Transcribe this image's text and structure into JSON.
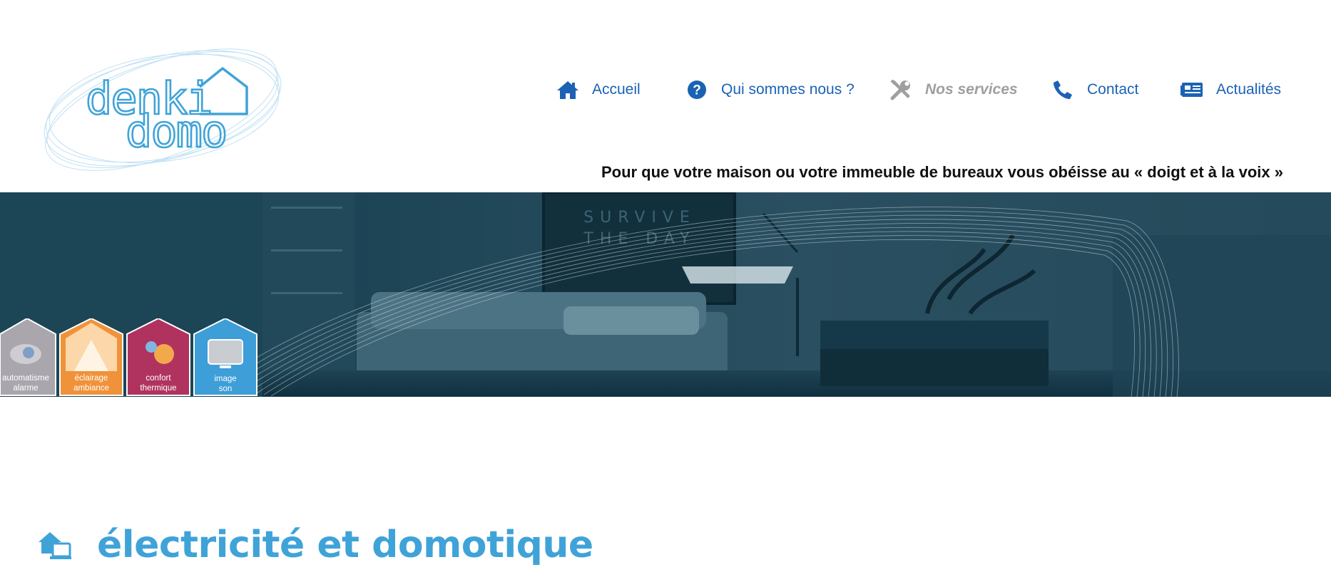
{
  "brand": {
    "logo_top": "denki",
    "logo_bottom": "domo",
    "colors": {
      "logo": "#3fa3d8",
      "nav": "#1b62b5",
      "nav_active": "#9f9f9f",
      "banner": "#1c4556",
      "title": "#3fa3d8"
    }
  },
  "nav": {
    "items": [
      {
        "label": "Accueil",
        "icon": "home-icon"
      },
      {
        "label": "Qui sommes nous ?",
        "icon": "question-circle-icon"
      },
      {
        "label": "Nos services",
        "icon": "tools-icon",
        "active": true
      },
      {
        "label": "Contact",
        "icon": "phone-icon"
      },
      {
        "label": "Actualités",
        "icon": "newspaper-icon"
      }
    ]
  },
  "tagline": "Pour que votre maison ou votre immeuble de bureaux vous obéisse au « doigt et à la voix »",
  "banner": {
    "wall_text_line1": "SURVIVE",
    "wall_text_line2": "THE DAY",
    "tiles": [
      {
        "line1": "automatisme",
        "line2": "alarme",
        "color": "#a9a6ad"
      },
      {
        "line1": "éclairage",
        "line2": "ambiance",
        "color": "#f0923a"
      },
      {
        "line1": "confort",
        "line2": "thermique",
        "color": "#b0335f"
      },
      {
        "line1": "image",
        "line2": "son",
        "color": "#3d9ed8"
      }
    ]
  },
  "section": {
    "title": "électricité et domotique",
    "icon": "house-devices-icon"
  }
}
